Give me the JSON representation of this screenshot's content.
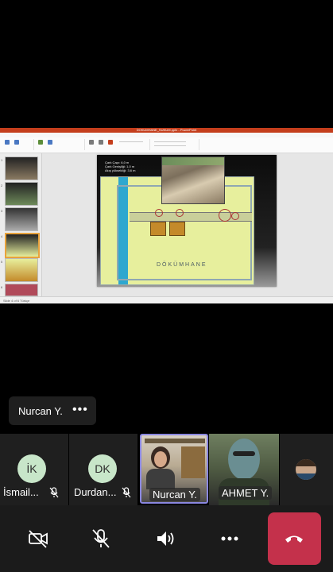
{
  "shared_screen": {
    "window_title": "DOKUMHANE_SUNUM.pptx - PowerPoint",
    "ribbon_tabs": [
      "File",
      "Home",
      "Insert",
      "Design",
      "Transitions",
      "Animations",
      "Slide Show",
      "Review",
      "View",
      "Help",
      "Shape Format"
    ],
    "slide": {
      "caption_line1": "Çark Çapı: 6,0 m",
      "caption_line2": "Çark Genişliği: 1,0 m",
      "caption_line3": "Akış yüksekliği: 3,6 m",
      "plan_title": "DÖKÜMHANE"
    },
    "thumbnail_count": 6,
    "selected_thumbnail": 4,
    "status_text": "Slide 4 of 6  Türkçe"
  },
  "speaker_pill": {
    "name": "Nurcan Y.",
    "more_icon": "more-dots-icon"
  },
  "participants": [
    {
      "initials": "İK",
      "name": "İsmail...",
      "avatar_color": "#c8e6c9",
      "muted": true
    },
    {
      "initials": "DK",
      "name": "Durdan...",
      "avatar_color": "#c8e6c9",
      "muted": true
    },
    {
      "name": "Nurcan Y.",
      "video": true,
      "active": true
    },
    {
      "name": "AHMET Y.",
      "video": true
    },
    {
      "name": "",
      "video": true,
      "partial": true
    }
  ],
  "controls": {
    "camera": "camera-off-icon",
    "mic": "mic-off-icon",
    "speaker": "speaker-icon",
    "more": "more-dots-icon",
    "hangup": "hang-up-icon",
    "hangup_color": "#c4314b"
  }
}
